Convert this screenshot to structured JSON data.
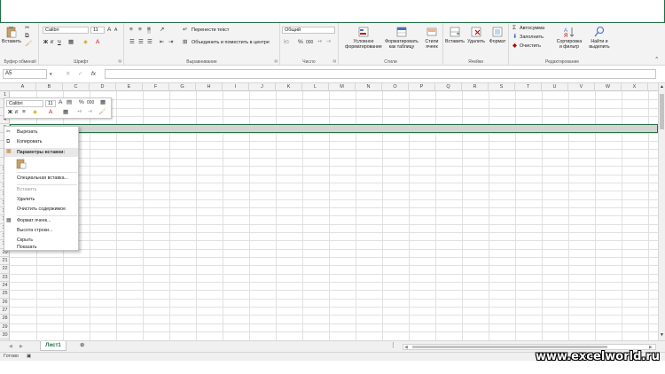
{
  "ribbon": {
    "clipboard": {
      "paste": "Вставить",
      "label": "Буфер обмена"
    },
    "font": {
      "name": "Calibri",
      "size": "11",
      "bold": "Ж",
      "italic": "К",
      "underline": "Ч",
      "label": "Шрифт"
    },
    "alignment": {
      "wrap": "Перенести текст",
      "merge": "Объединить и поместить в центре",
      "label": "Выравнивание"
    },
    "number": {
      "format": "Общий",
      "label": "Число"
    },
    "styles": {
      "conditional": "Условное\nформатирование",
      "as_table": "Форматировать\nкак таблицу",
      "cell_styles": "Стили\nячеек",
      "label": "Стили"
    },
    "cells": {
      "insert": "Вставить",
      "delete": "Удалить",
      "format": "Формат",
      "label": "Ячейки"
    },
    "editing": {
      "autosum": "Автосумма",
      "fill": "Заполнить",
      "clear": "Очистить",
      "sort": "Сортировка\nи фильтр",
      "find": "Найти и\nвыделить",
      "label": "Редактирование"
    }
  },
  "formula_bar": {
    "name_box": "A5",
    "fx": "fx",
    "cancel": "✕",
    "confirm": "✓"
  },
  "columns": [
    "A",
    "B",
    "C",
    "D",
    "E",
    "F",
    "G",
    "H",
    "I",
    "J",
    "K",
    "L",
    "M",
    "N",
    "O",
    "P",
    "Q",
    "R",
    "S",
    "T",
    "U",
    "V",
    "W",
    "X"
  ],
  "rows": [
    "1",
    "2",
    "3",
    "4",
    "5",
    "6",
    "7",
    "8",
    "9",
    "10",
    "11",
    "12",
    "13",
    "14",
    "15",
    "16",
    "17",
    "18",
    "19",
    "20",
    "21",
    "22",
    "23",
    "24",
    "25",
    "26",
    "27",
    "28",
    "29",
    "30"
  ],
  "mini_toolbar": {
    "font": "Calibri",
    "size": "11"
  },
  "context_menu": {
    "cut": "Вырезать",
    "copy": "Копировать",
    "paste_header": "Параметры вставки:",
    "paste_special": "Специальная вставка...",
    "insert": "Вставить",
    "delete": "Удалить",
    "clear": "Очистить содержимое",
    "format_cells": "Формат ячеек...",
    "row_height": "Высота строки...",
    "hide": "Скрыть",
    "unhide": "Показать"
  },
  "sheet_tab": "Лист1",
  "status": "Готово",
  "watermark": "www.excelworld.ru",
  "colors": {
    "accent": "#217346",
    "ribbon_bg": "#f3f3f3",
    "selection": "#d4d4d4"
  }
}
